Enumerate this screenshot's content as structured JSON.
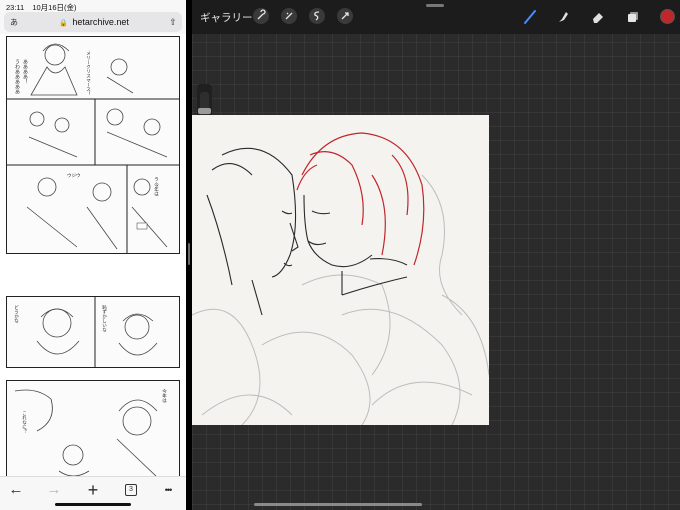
{
  "status": {
    "time": "23:11",
    "date": "10月16日(金)"
  },
  "browser": {
    "url": "hetarchive.net",
    "lock_glyph": "🔒",
    "reader_label": "あ",
    "share_glyph": "⇧",
    "tab_count": "3",
    "back_glyph": "←",
    "forward_glyph": "→",
    "new_tab_glyph": "+",
    "more_glyph": "•••"
  },
  "manga": {
    "page1": {
      "exclaim_1": "うわあああああ",
      "exclaim_2": "ああああ！",
      "caption_1": "メリークリスマース！",
      "caption_2": "ラ 今年は",
      "sfx": "ウジウ"
    },
    "page2": {
      "caption_1": "どうかな",
      "caption_2": "恥ずかしいな"
    },
    "page3": {
      "caption_1": "これなに？",
      "caption_2": "今年は"
    }
  },
  "procreate": {
    "gallery_label": "ギャラリー",
    "accent_color": "#c0262a",
    "active_tool_color": "#4a8cff"
  }
}
